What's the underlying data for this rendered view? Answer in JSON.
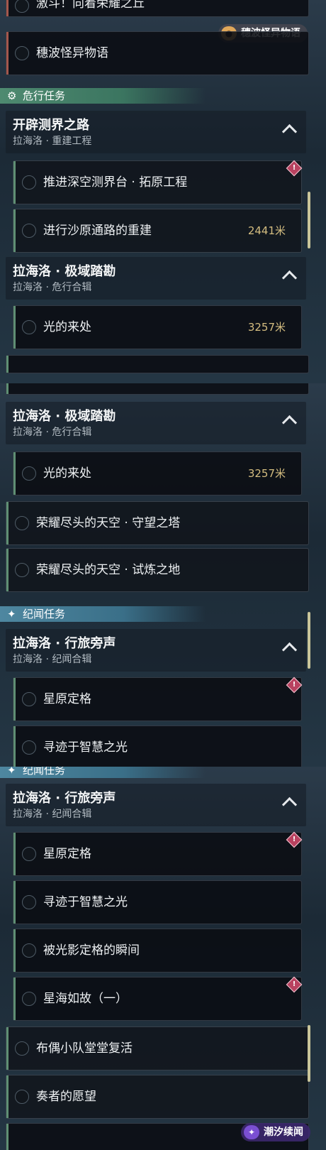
{
  "watermarks": {
    "top": "穗波怪异物语",
    "bottom": "潮汐续闻"
  },
  "panel1": {
    "top_item": "激斗！向着荣耀之丘",
    "top_item2": "穗波怪异物语",
    "section": "危行任务",
    "group1": {
      "title": "开辟测界之路",
      "subtitle": "拉海洛 · 重建工程"
    },
    "task1": "推进深空测界台 · 拓原工程",
    "task2": "进行沙原通路的重建",
    "task2_dist": "2441米",
    "group2": {
      "title": "拉海洛 · 极域踏勘",
      "subtitle": "拉海洛 · 危行合辑"
    },
    "task3": "光的来处",
    "task3_dist": "3257米"
  },
  "panel2": {
    "group": {
      "title": "拉海洛 · 极域踏勘",
      "subtitle": "拉海洛 · 危行合辑"
    },
    "task1": "光的来处",
    "task1_dist": "3257米",
    "task2": "荣耀尽头的天空 · 守望之塔",
    "task3": "荣耀尽头的天空 · 试炼之地",
    "section": "纪闻任务",
    "group2": {
      "title": "拉海洛 · 行旅旁声",
      "subtitle": "拉海洛 · 纪闻合辑"
    },
    "task4": "星原定格",
    "task5": "寻迹于智慧之光"
  },
  "panel3": {
    "section": "纪闻任务",
    "group": {
      "title": "拉海洛 · 行旅旁声",
      "subtitle": "拉海洛 · 纪闻合辑"
    },
    "task1": "星原定格",
    "task2": "寻迹于智慧之光",
    "task3": "被光影定格的瞬间",
    "task4": "星海如故（一）",
    "task5": "布偶小队堂堂复活",
    "task6": "奏者的愿望"
  },
  "icons": {
    "alert": "!",
    "section_gear": "gear-icon",
    "section_star": "sparkle-icon"
  }
}
